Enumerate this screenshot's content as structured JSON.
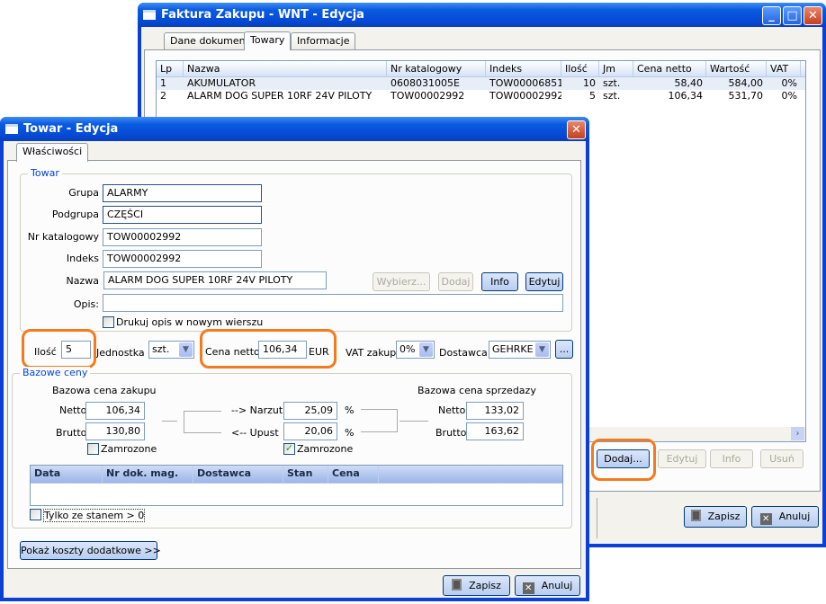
{
  "back_window": {
    "title": "Faktura Zakupu - WNT - Edycja",
    "tabs": [
      "Dane dokumentu",
      "Towary",
      "Informacje"
    ],
    "active_tab": "Towary",
    "grid": {
      "columns": [
        "Lp",
        "Nazwa",
        "Nr katalogowy",
        "Indeks",
        "Ilość",
        "Jm",
        "Cena netto",
        "Wartość",
        "VAT"
      ],
      "rows": [
        [
          "1",
          "AKUMULATOR",
          "0608031005E",
          "TOW00006851",
          "10",
          "szt.",
          "58,40",
          "584,00",
          "0%"
        ],
        [
          "2",
          "ALARM DOG SUPER 10RF 24V PILOTY",
          "TOW00002992",
          "TOW00002992",
          "5",
          "szt.",
          "106,34",
          "531,70",
          "0%"
        ]
      ]
    },
    "buttons": {
      "add": "Dodaj...",
      "edit": "Edytuj",
      "info": "Info",
      "delete": "Usuń",
      "save": "Zapisz",
      "cancel": "Anuluj"
    }
  },
  "front_window": {
    "title": "Towar - Edycja",
    "tab": "Właściwości",
    "towar": {
      "group_title": "Towar",
      "grupa_label": "Grupa",
      "grupa": "ALARMY",
      "podgrupa_label": "Podgrupa",
      "podgrupa": "CZĘŚCI",
      "nrkat_label": "Nr katalogowy",
      "nrkat": "TOW00002992",
      "indeks_label": "Indeks",
      "indeks": "TOW00002992",
      "nazwa_label": "Nazwa",
      "nazwa": "ALARM DOG SUPER 10RF 24V PILOTY",
      "wybierz": "Wybierz...",
      "dodaj": "Dodaj",
      "info": "Info",
      "edytuj": "Edytuj",
      "opis_label": "Opis:",
      "opis": "",
      "drukuj_label": "Drukuj opis w nowym wierszu",
      "drukuj_checked": false
    },
    "row": {
      "ilosc_label": "Ilość",
      "ilosc": "5",
      "jednostka_label": "Jednostka",
      "jednostka": "szt.",
      "cena_label": "Cena netto",
      "cena": "106,34",
      "waluta": "EUR",
      "vat_label": "VAT zakup",
      "vat": "0%",
      "dostawca_label": "Dostawca",
      "dostawca": "GEHRKE G",
      "more": "..."
    },
    "bazowe": {
      "group_title": "Bazowe ceny",
      "zakup_title": "Bazowa cena zakupu",
      "sprzedaz_title": "Bazowa cena sprzedazy",
      "netto_label": "Netto",
      "brutto_label": "Brutto",
      "zakup_netto": "106,34",
      "zakup_brutto": "130,80",
      "narzut_label": "--> Narzut",
      "narzut": "25,09",
      "upust_label": "<--  Upust",
      "upust": "20,06",
      "pct": "%",
      "sprz_netto": "133,02",
      "sprz_brutto": "163,62",
      "zamrozone_label": "Zamrozone",
      "zamrozone_zakup": false,
      "zamrozone_narzut": true,
      "columns": [
        "Data",
        "Nr dok. mag.",
        "Dostawca",
        "Stan",
        "Cena"
      ],
      "tylko_label": "Tylko ze stanem > 0"
    },
    "koszty_button": "Pokaż koszty dodatkowe >>",
    "save": "Zapisz",
    "cancel": "Anuluj"
  },
  "colors": {
    "highlight": "#f57a1d",
    "title_blue": "#0a5be0",
    "group_title": "#0046d5"
  }
}
